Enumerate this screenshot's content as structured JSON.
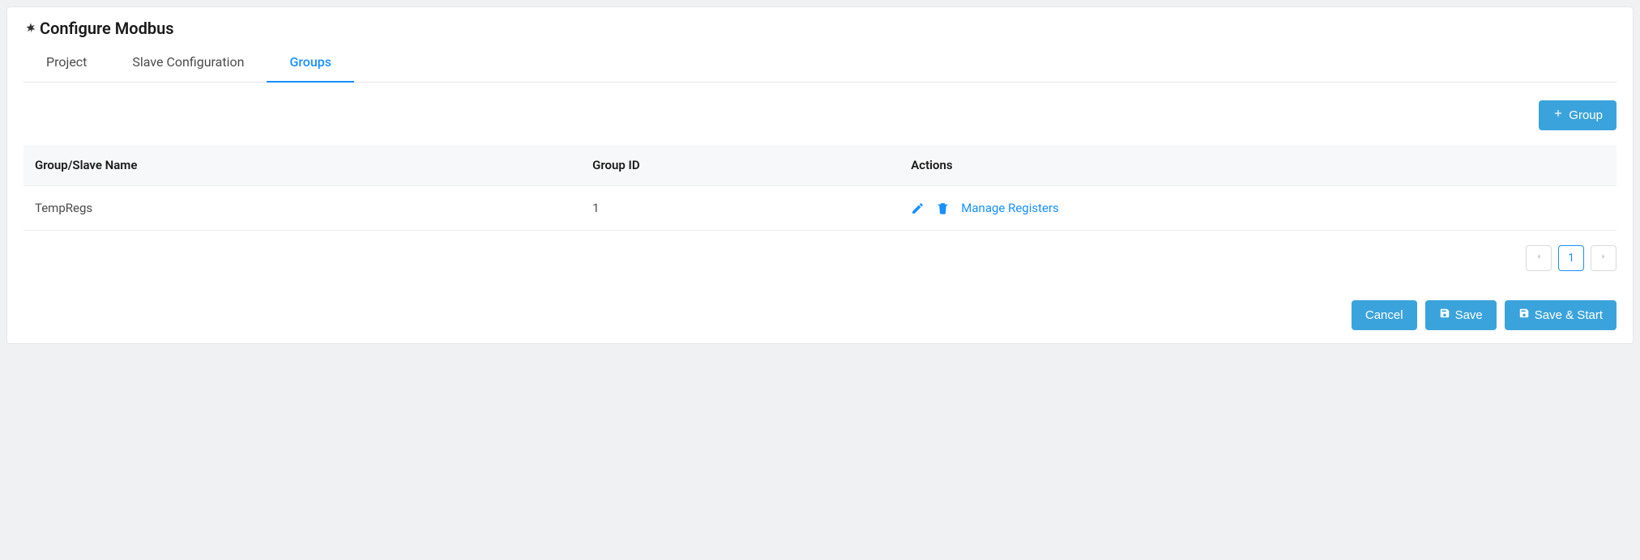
{
  "header": {
    "title": "Configure Modbus"
  },
  "tabs": [
    {
      "label": "Project",
      "active": false
    },
    {
      "label": "Slave Configuration",
      "active": false
    },
    {
      "label": "Groups",
      "active": true
    }
  ],
  "toolbar": {
    "add_group_label": "Group"
  },
  "table": {
    "headers": {
      "name": "Group/Slave Name",
      "id": "Group ID",
      "actions": "Actions"
    },
    "rows": [
      {
        "name": "TempRegs",
        "id": "1",
        "manage_label": "Manage Registers"
      }
    ]
  },
  "pagination": {
    "current": "1"
  },
  "footer": {
    "cancel": "Cancel",
    "save": "Save",
    "save_start": "Save & Start"
  }
}
